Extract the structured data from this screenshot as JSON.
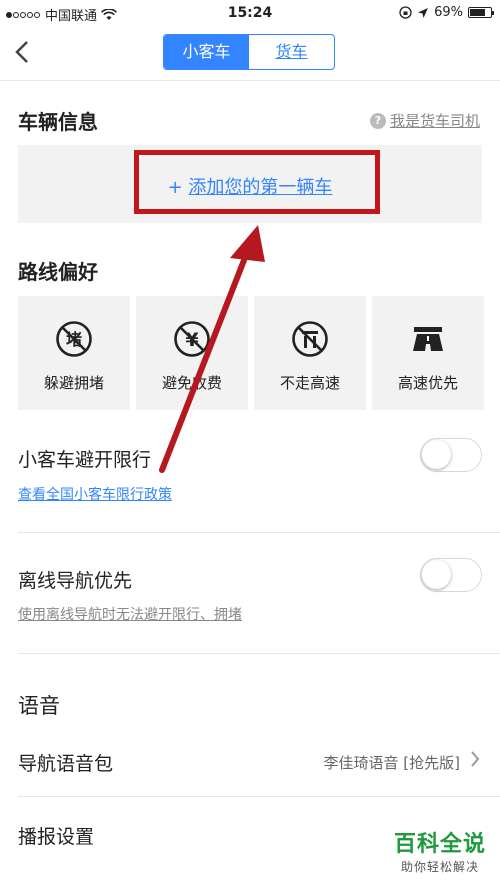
{
  "status_bar": {
    "carrier": "中国联通",
    "time": "15:24",
    "battery": "69%"
  },
  "nav": {
    "back_icon": "chevron-left-icon",
    "tabs": [
      {
        "label": "小客车",
        "active": true
      },
      {
        "label": "货车",
        "active": false
      }
    ]
  },
  "vehicle": {
    "title": "车辆信息",
    "truck_link": "我是货车司机",
    "add_car": "添加您的第一辆车"
  },
  "route": {
    "title": "路线偏好",
    "options": [
      {
        "label": "躲避拥堵",
        "icon": "avoid-congestion-icon"
      },
      {
        "label": "避免收费",
        "icon": "avoid-toll-icon"
      },
      {
        "label": "不走高速",
        "icon": "no-highway-icon"
      },
      {
        "label": "高速优先",
        "icon": "highway-first-icon"
      }
    ]
  },
  "restriction": {
    "title": "小客车避开限行",
    "link": "查看全国小客车限行政策",
    "enabled": false
  },
  "offline": {
    "title": "离线导航优先",
    "note": "使用离线导航时无法避开限行、拥堵",
    "enabled": false
  },
  "voice": {
    "title": "语音",
    "package_label": "导航语音包",
    "package_value": "李佳琦语音 [抢先版]",
    "broadcast_label": "播报设置"
  },
  "watermark": {
    "title": "百科全说",
    "subtitle": "助你轻松解决"
  },
  "colors": {
    "accent": "#3385ff",
    "highlight": "#c0161c"
  }
}
